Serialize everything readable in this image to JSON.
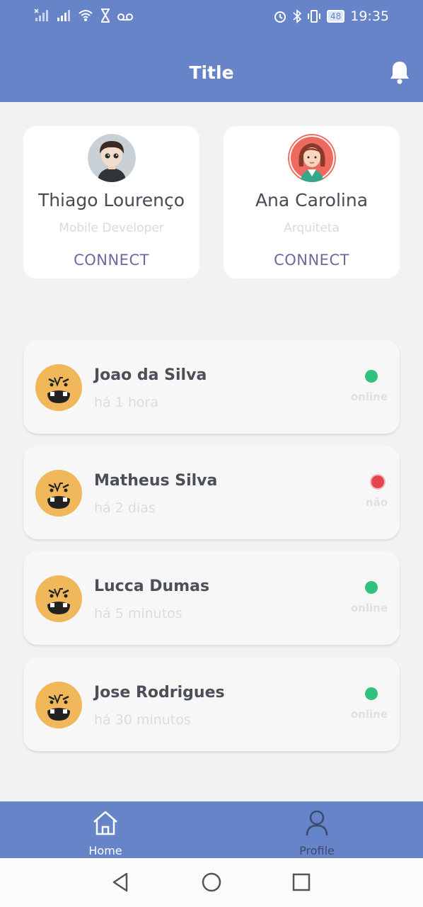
{
  "status_bar": {
    "time": "19:35",
    "battery": "48"
  },
  "app_bar": {
    "title": "Title",
    "bell_icon": "bell-icon"
  },
  "profiles": [
    {
      "name": "Thiago Lourenço",
      "role": "Mobile Developer",
      "action": "CONNECT"
    },
    {
      "name": "Ana Carolina",
      "role": "Arquiteta",
      "action": "CONNECT"
    }
  ],
  "contacts": [
    {
      "name": "Joao da Silva",
      "time": "há 1 hora",
      "status": "online",
      "status_color": "#2ec27e"
    },
    {
      "name": "Matheus Silva",
      "time": "há 2 dias",
      "status": "não",
      "status_color": "#e5454f"
    },
    {
      "name": "Lucca Dumas",
      "time": "há 5 minutos",
      "status": "online",
      "status_color": "#2ec27e"
    },
    {
      "name": "Jose Rodrigues",
      "time": "há 30 minutos",
      "status": "online",
      "status_color": "#2ec27e"
    }
  ],
  "bottom_nav": {
    "home_label": "Home",
    "profile_label": "Profile"
  },
  "colors": {
    "accent": "#6784c9",
    "face": "#f0b85a",
    "online": "#2ec27e",
    "offline": "#e5454f"
  }
}
